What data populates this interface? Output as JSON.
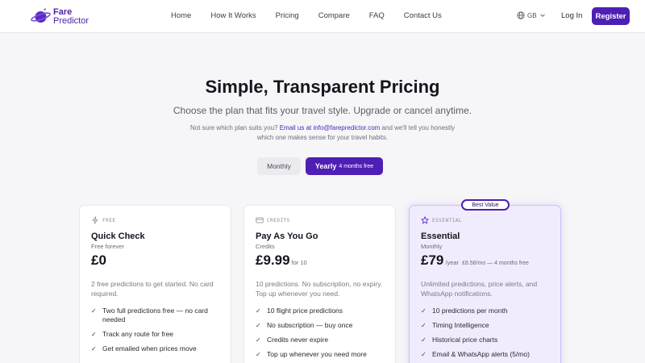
{
  "brand": {
    "line1": "Fare",
    "line2": "Predictor",
    "color": "#4e1fb4"
  },
  "nav": {
    "links": [
      "Home",
      "How It Works",
      "Pricing",
      "Compare",
      "FAQ",
      "Contact Us"
    ],
    "lang": "GB",
    "login": "Log In",
    "register": "Register"
  },
  "hero": {
    "title": "Simple, Transparent Pricing",
    "subtitle": "Choose the plan that fits your travel style. Upgrade or cancel anytime.",
    "note_before": "Not sure which plan suits you? ",
    "note_link": "Email us at info@farepredictor.com",
    "note_after": " and we'll tell you honestly which one makes sense for your travel habits."
  },
  "billing_toggle": {
    "monthly": "Monthly",
    "yearly": "Yearly",
    "yearly_badge": "4 months free",
    "selected": "Yearly"
  },
  "plans": [
    {
      "tag": "FREE",
      "icon": "lightning-icon",
      "name": "Quick Check",
      "sub": "Free forever",
      "price": "£0",
      "price_suffix": "",
      "price_extra": "",
      "description": "2 free predictions to get started. No card required.",
      "features": [
        "Two full predictions free — no card needed",
        "Track any route for free",
        "Get emailed when prices move"
      ]
    },
    {
      "tag": "CREDITS",
      "icon": "credit-card-icon",
      "name": "Pay As You Go",
      "sub": "Credits",
      "price": "£9.99",
      "price_suffix": "for 10",
      "price_extra": "",
      "description": "10 predictions. No subscription, no expiry. Top up whenever you need.",
      "features": [
        "10 flight price predictions",
        "No subscription — buy once",
        "Credits never expire",
        "Top up whenever you need more"
      ]
    },
    {
      "tag": "ESSENTIAL",
      "icon": "star-icon",
      "name": "Essential",
      "sub": "Monthly",
      "price": "£79",
      "price_suffix": "/year",
      "price_extra": "£6.58/mo — 4 months free",
      "badge": "Best Value",
      "description": "Unlimited predictions, price alerts, and WhatsApp notifications.",
      "features": [
        "10 predictions per month",
        "Timing Intelligence",
        "Historical price charts",
        "Email & WhatsApp alerts (5/mo)"
      ]
    }
  ]
}
